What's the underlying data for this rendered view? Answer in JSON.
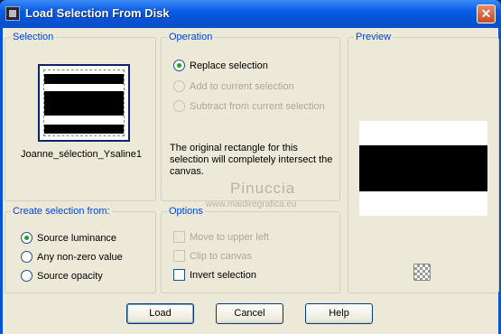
{
  "window": {
    "title": "Load Selection From Disk",
    "close_glyph": "✕"
  },
  "selection": {
    "group_label": "Selection",
    "file_name": "Joanne_sélection_Ysaline1"
  },
  "operation": {
    "group_label": "Operation",
    "options": [
      {
        "label": "Replace selection",
        "selected": true,
        "enabled": true
      },
      {
        "label": "Add to current selection",
        "selected": false,
        "enabled": false
      },
      {
        "label": "Subtract from current selection",
        "selected": false,
        "enabled": false
      }
    ],
    "info_text": "The original rectangle for this selection will completely intersect the canvas."
  },
  "preview": {
    "group_label": "Preview",
    "transparency_icon": "checkerboard-icon"
  },
  "create_from": {
    "group_label": "Create selection from:",
    "options": [
      {
        "label": "Source luminance",
        "selected": true
      },
      {
        "label": "Any non-zero value",
        "selected": false
      },
      {
        "label": "Source opacity",
        "selected": false
      }
    ]
  },
  "options": {
    "group_label": "Options",
    "checks": [
      {
        "label": "Move to upper left",
        "checked": false,
        "enabled": false
      },
      {
        "label": "Clip to canvas",
        "checked": false,
        "enabled": false
      },
      {
        "label": "Invert selection",
        "checked": false,
        "enabled": true
      }
    ]
  },
  "buttons": {
    "load": "Load",
    "cancel": "Cancel",
    "help": "Help"
  },
  "watermark": {
    "main": "Pinuccia",
    "sub": "www.maidiregrafica.eu"
  },
  "colors": {
    "title_bar": "#0653d6",
    "group_label": "#0046d5",
    "radio_dot": "#21a121",
    "dialog_bg": "#ece9d8"
  }
}
